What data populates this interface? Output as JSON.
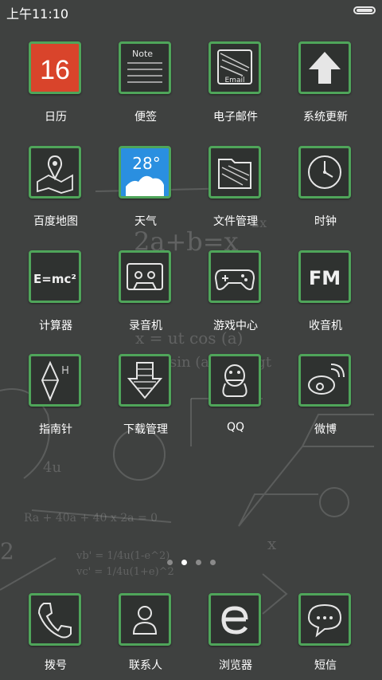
{
  "status_bar": {
    "time": "上午11:10"
  },
  "apps": [
    {
      "label": "日历",
      "icon": "calendar-icon",
      "badge": "16"
    },
    {
      "label": "便签",
      "icon": "notes-icon",
      "title": "Note"
    },
    {
      "label": "电子邮件",
      "icon": "email-icon",
      "title": "Email"
    },
    {
      "label": "系统更新",
      "icon": "update-arrow-icon"
    },
    {
      "label": "百度地图",
      "icon": "map-icon"
    },
    {
      "label": "天气",
      "icon": "weather-icon",
      "temp": "28°"
    },
    {
      "label": "文件管理",
      "icon": "folder-icon"
    },
    {
      "label": "时钟",
      "icon": "clock-icon"
    },
    {
      "label": "计算器",
      "icon": "calculator-icon",
      "formula": "E=mc²"
    },
    {
      "label": "录音机",
      "icon": "cassette-icon"
    },
    {
      "label": "游戏中心",
      "icon": "gamepad-icon"
    },
    {
      "label": "收音机",
      "icon": "radio-icon",
      "title": "FM"
    },
    {
      "label": "指南针",
      "icon": "compass-icon"
    },
    {
      "label": "下载管理",
      "icon": "download-icon"
    },
    {
      "label": "QQ",
      "icon": "qq-penguin-icon"
    },
    {
      "label": "微博",
      "icon": "weibo-icon"
    }
  ],
  "dock": [
    {
      "label": "拨号",
      "icon": "phone-icon"
    },
    {
      "label": "联系人",
      "icon": "contacts-icon"
    },
    {
      "label": "浏览器",
      "icon": "browser-icon"
    },
    {
      "label": "短信",
      "icon": "message-icon"
    }
  ],
  "page_indicator": {
    "count": 4,
    "active": 1
  },
  "chalkboard": {
    "eq1": "2a+b=x",
    "eq1_sub": "2x",
    "eq2": "x = ut cos (a)",
    "eq3": "t sin (a) - 1/2 gt",
    "eq4": "Ra + 40a + 40 x 2a = 0",
    "eq5": "vb' = 1/4u(1-e^2)",
    "eq6": "vc' = 1/4u(1+e)^2",
    "n1": "4u",
    "n2": "2",
    "n3": "x"
  },
  "colors": {
    "background": "#3f4140",
    "icon_border": "#4fa55a",
    "calendar_red": "#d9442b",
    "weather_blue": "#2a8fe0"
  }
}
